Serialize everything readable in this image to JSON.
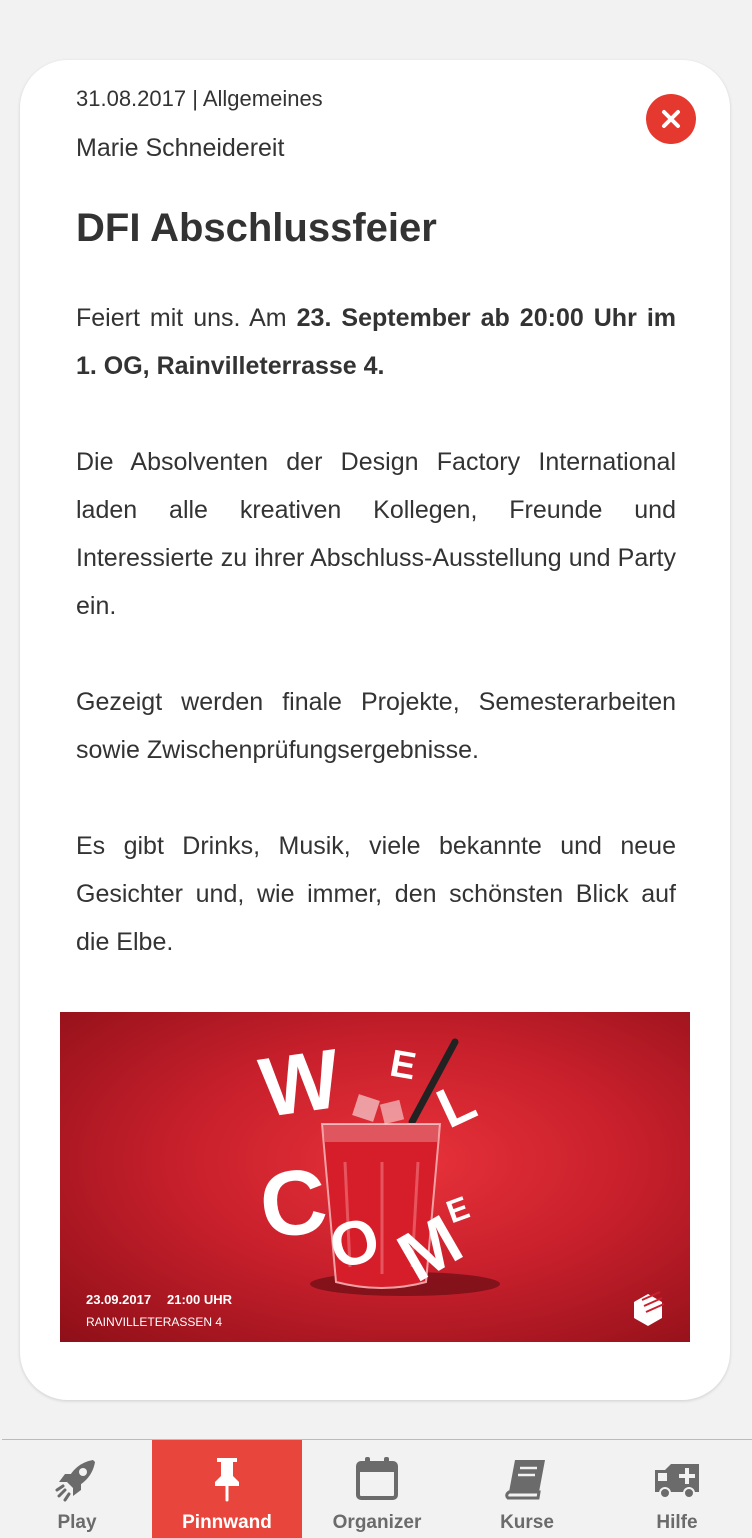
{
  "post": {
    "meta": "31.08.2017 | Allgemeines",
    "author": "Marie Schneidereit",
    "title": "DFI Abschlussfeier",
    "p1_plain": "Feiert mit uns. Am ",
    "p1_bold": "23. September ab 20:00 Uhr im 1. OG, Rainvilleterrasse 4.",
    "p2": "Die Absolventen der Design Factory International laden alle kreativen Kollegen, Freunde und Interessierte zu ihrer Abschluss-Ausstellung und Party ein.",
    "p3": "Gezeigt werden finale Projekte, Semesterarbeiten sowie Zwischenprüfungsergebnisse.",
    "p4": "Es gibt Drinks, Musik, viele bekannte und neue Gesichter und, wie immer, den schönsten Blick auf die Elbe."
  },
  "poster": {
    "letters": [
      "W",
      "E",
      "L",
      "C",
      "O",
      "M",
      "E"
    ],
    "date": "23.09.2017",
    "time": "21:00 UHR",
    "location": "RAINVILLETERASSEN 4"
  },
  "tabs": [
    {
      "label": "Play",
      "icon": "rocket-icon"
    },
    {
      "label": "Pinnwand",
      "icon": "pin-icon",
      "active": true
    },
    {
      "label": "Organizer",
      "icon": "calendar-icon"
    },
    {
      "label": "Kurse",
      "icon": "book-icon"
    },
    {
      "label": "Hilfe",
      "icon": "ambulance-icon"
    }
  ],
  "colors": {
    "accent": "#e8463c",
    "close": "#e5392f",
    "text": "#333333",
    "tab_text": "#6b6b6b",
    "poster_red": "#c8202c"
  }
}
